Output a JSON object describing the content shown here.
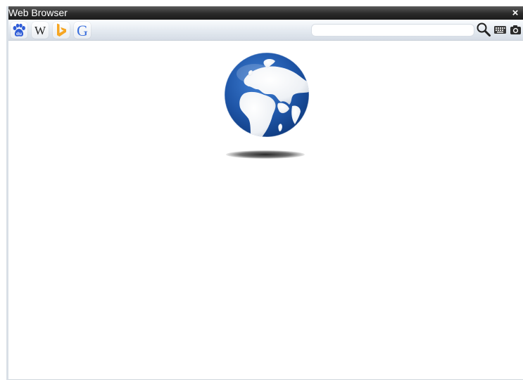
{
  "window": {
    "title": "Web Browser",
    "close_glyph": "×"
  },
  "toolbar": {
    "engines": [
      {
        "name": "baidu",
        "icon": "baidu-paw-icon",
        "glyph": "du",
        "color": "#2f5cd6"
      },
      {
        "name": "wikipedia",
        "icon": "wikipedia-w-icon",
        "glyph": "W",
        "color": "#222222"
      },
      {
        "name": "bing",
        "icon": "bing-b-icon",
        "color": "#f6a623"
      },
      {
        "name": "google",
        "icon": "google-g-icon",
        "glyph": "G",
        "color": "#3b6fdc"
      }
    ],
    "search": {
      "value": "",
      "placeholder": ""
    },
    "buttons": [
      {
        "name": "search",
        "icon": "magnifier-icon"
      },
      {
        "name": "keyboard",
        "icon": "keyboard-icon"
      },
      {
        "name": "screenshot",
        "icon": "camera-icon"
      }
    ]
  },
  "content": {
    "image": "globe-icon",
    "globe_ocean": "#1f56a8",
    "globe_land": "#f2f4f7"
  }
}
